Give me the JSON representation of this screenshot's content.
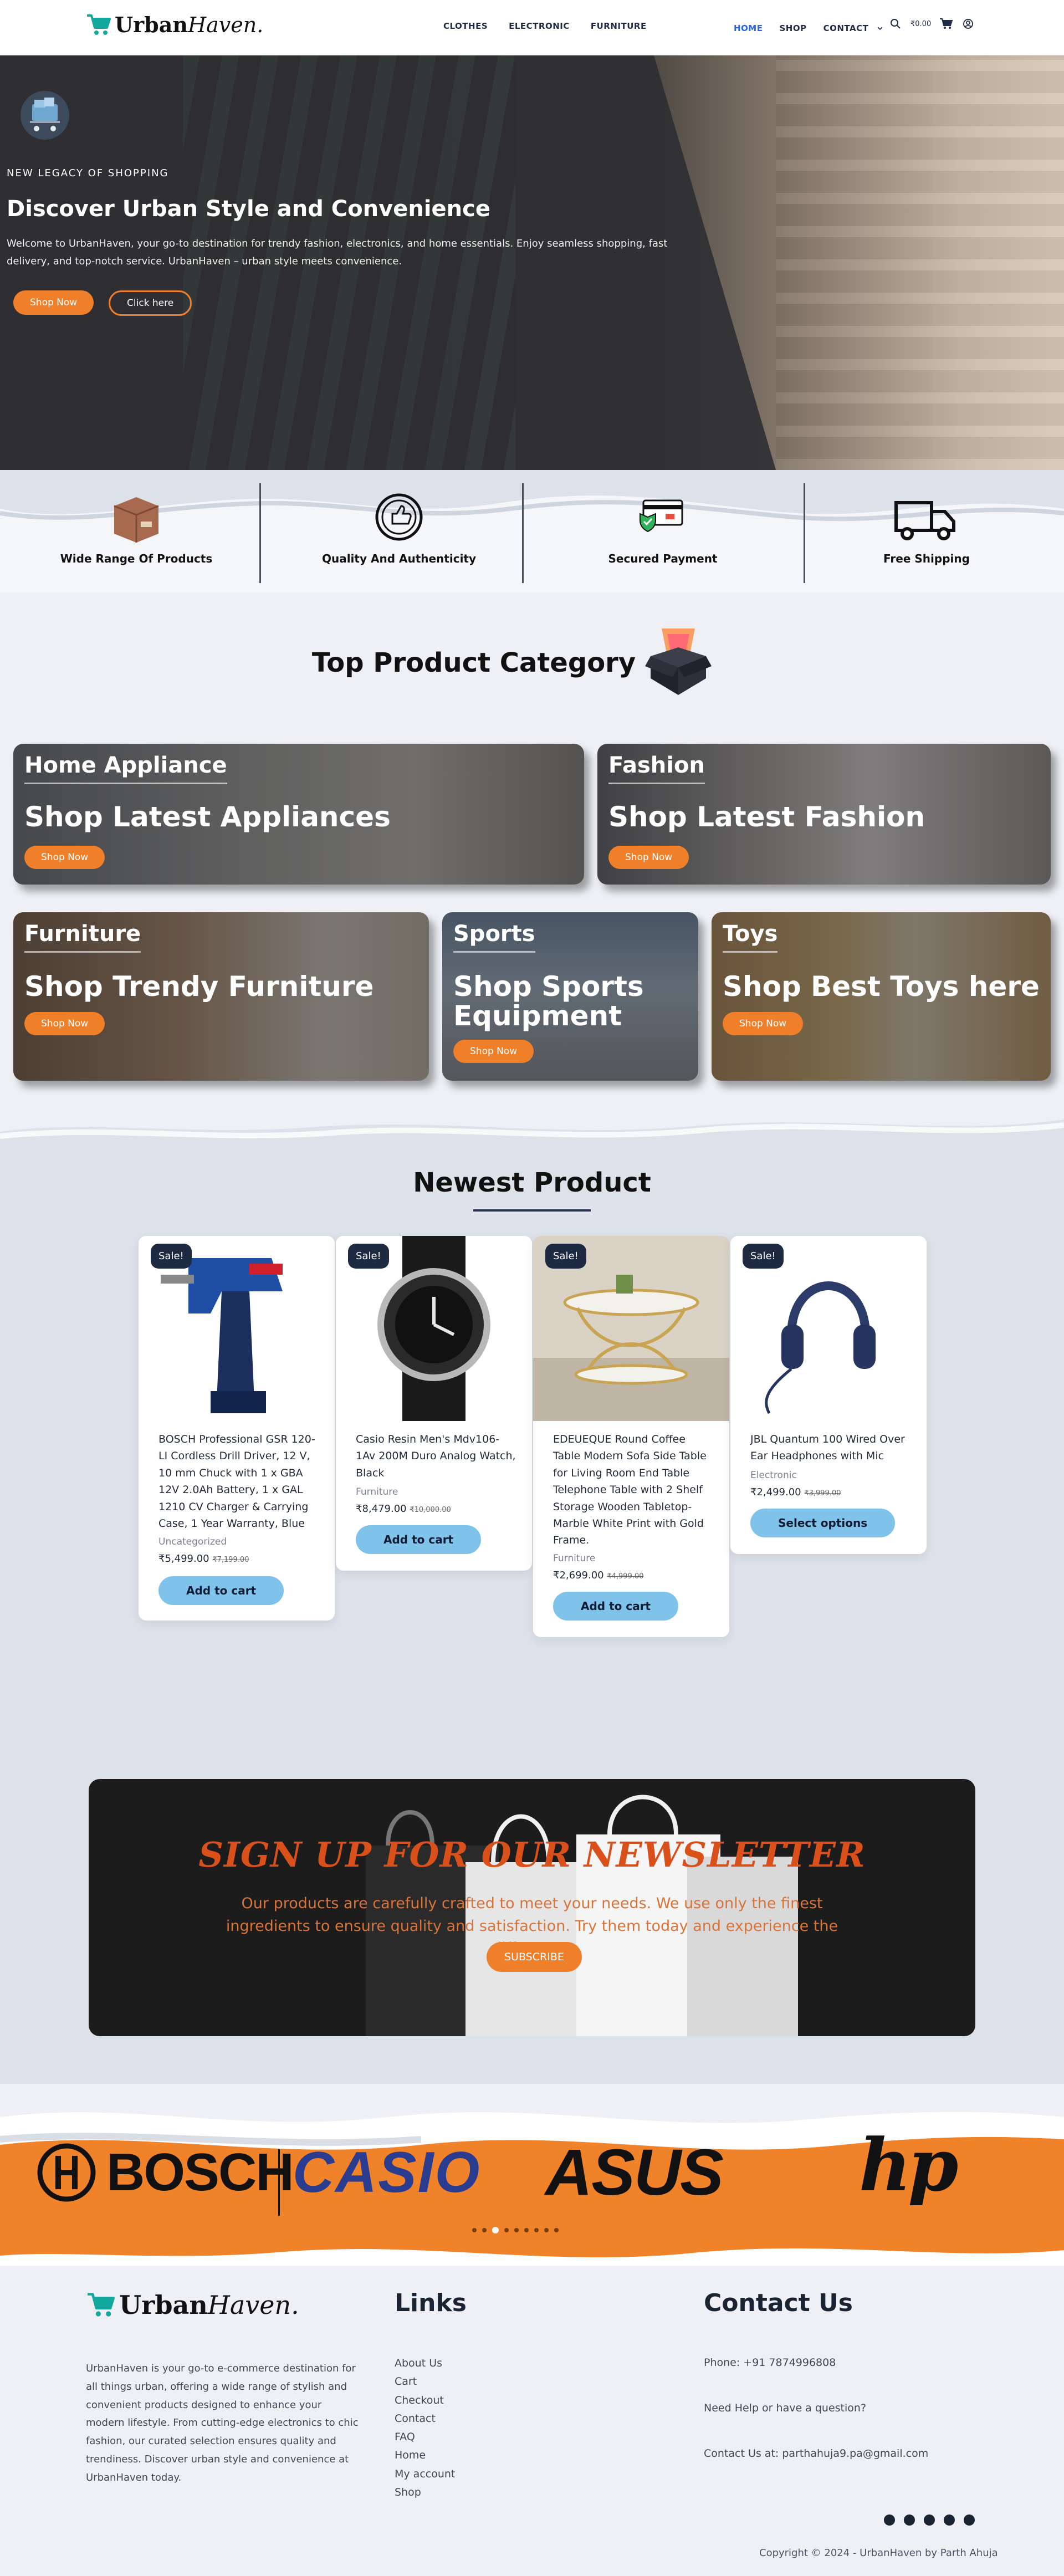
{
  "header": {
    "logo": {
      "brand": "Urban",
      "brand_tail": "Haven."
    },
    "categories": [
      "CLOTHES",
      "ELECTRONIC",
      "FURNITURE"
    ],
    "nav": [
      "HOME",
      "SHOP",
      "CONTACT"
    ],
    "active_nav": "HOME",
    "cart_total": "₹0.00",
    "icons": [
      "search-icon",
      "cart-icon",
      "user-icon",
      "chevron-down-icon"
    ]
  },
  "hero": {
    "kicker": "NEW LEGACY OF SHOPPING",
    "title": "Discover Urban Style and Convenience",
    "description": "Welcome to UrbanHaven, your go-to destination for trendy fashion, electronics, and home essentials. Enjoy seamless shopping, fast delivery, and top-notch service. UrbanHaven – urban style meets convenience.",
    "primary_button": "Shop Now",
    "secondary_button": "Click here"
  },
  "features": [
    {
      "label": "Wide Range Of Products",
      "icon": "box-icon"
    },
    {
      "label": "Quality And Authenticity",
      "icon": "thumbs-up-badge-icon"
    },
    {
      "label": "Secured Payment",
      "icon": "card-shield-icon"
    },
    {
      "label": "Free Shipping",
      "icon": "truck-icon"
    }
  ],
  "categories": {
    "title": "Top Product Category",
    "items": [
      {
        "heading": "Home Appliance",
        "tagline": "Shop Latest Appliances",
        "button": "Shop Now"
      },
      {
        "heading": "Fashion",
        "tagline": "Shop Latest Fashion",
        "button": "Shop Now"
      },
      {
        "heading": "Furniture",
        "tagline": "Shop Trendy Furniture",
        "button": "Shop Now"
      },
      {
        "heading": "Sports",
        "tagline": "Shop Sports Equipment",
        "button": "Shop Now"
      },
      {
        "heading": "Toys",
        "tagline": "Shop Best Toys here",
        "button": "Shop Now"
      }
    ]
  },
  "newest": {
    "title": "Newest Product",
    "products": [
      {
        "badge": "Sale!",
        "name": "BOSCH Professional GSR 120-LI Cordless Drill Driver, 12 V, 10 mm Chuck with 1 x GBA 12V 2.0Ah Battery, 1 x GAL 1210 CV Charger & Carrying Case, 1 Year Warranty, Blue",
        "category": "Uncategorized",
        "price": "₹5,499.00",
        "old_price": "₹7,199.00",
        "button": "Add to cart"
      },
      {
        "badge": "Sale!",
        "name": "Casio Resin Men's Mdv106-1Av 200M Duro Analog Watch, Black",
        "category": "Furniture",
        "price": "₹8,479.00",
        "old_price": "₹10,000.00",
        "button": "Add to cart"
      },
      {
        "badge": "Sale!",
        "name": "EDEUEQUE Round Coffee Table Modern Sofa Side Table for Living Room End Table Telephone Table with 2 Shelf Storage Wooden Tabletop-Marble White Print with Gold Frame.",
        "category": "Furniture",
        "price": "₹2,699.00",
        "old_price": "₹4,999.00",
        "button": "Add to cart"
      },
      {
        "badge": "Sale!",
        "name": "JBL Quantum 100 Wired Over Ear Headphones with Mic",
        "category": "Electronic",
        "price": "₹2,499.00",
        "old_price": "₹3,999.00",
        "button": "Select options"
      }
    ]
  },
  "newsletter": {
    "title": "SIGN UP FOR OUR NEWSLETTER",
    "description": "Our products are carefully crafted to meet your needs. We use only the finest ingredients to ensure quality and satisfaction. Try them today and experience the difference.",
    "button": "SUBSCRIBE"
  },
  "brands": [
    "BOSCH",
    "CASIO",
    "ASUS",
    "hp"
  ],
  "carousel": {
    "slides": 9,
    "active_index": 2
  },
  "footer": {
    "about": "UrbanHaven is your go-to e-commerce destination for all things urban, offering a wide range of stylish and convenient products designed to enhance your modern lifestyle. From cutting-edge electronics to chic fashion, our curated selection ensures quality and trendiness. Discover urban style and convenience at UrbanHaven today.",
    "links_title": "Links",
    "links": [
      "About Us",
      "Cart",
      "Checkout",
      "Contact",
      "FAQ",
      "Home",
      "My account",
      "Shop"
    ],
    "contact_title": "Contact Us",
    "phone": "Phone: +91 7874996808",
    "help": "Need Help or have a question?",
    "email": "Contact Us at: parthahuja9.pa@gmail.com",
    "socials": [
      "whatsapp-icon",
      "instagram-icon",
      "facebook-icon",
      "snapchat-icon",
      "x-icon"
    ],
    "copyright": "Copyright © 2024 - UrbanHaven by Parth Ahuja"
  },
  "colors": {
    "accent": "#f07f2a",
    "navy": "#1e2a42",
    "link_active": "#2563eb",
    "cart_button": "#7fc3ea"
  }
}
